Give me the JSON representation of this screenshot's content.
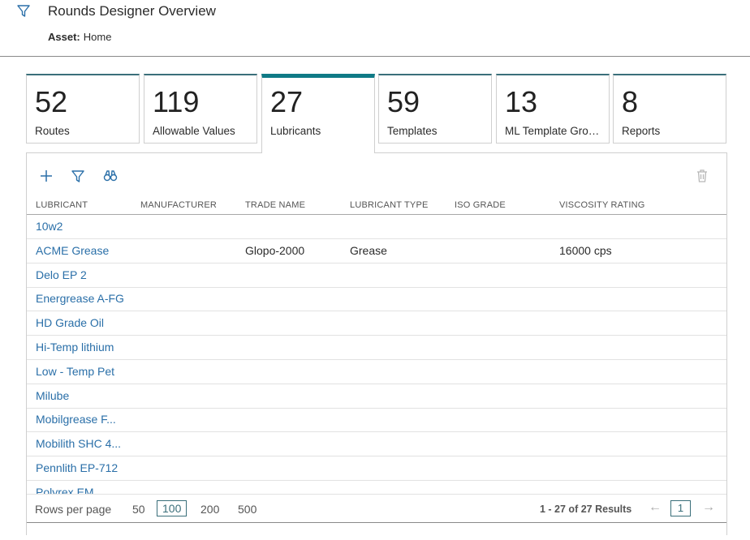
{
  "header": {
    "title": "Rounds Designer Overview",
    "asset_label": "Asset:",
    "asset_value": "Home"
  },
  "tiles": [
    {
      "count": "52",
      "label": "Routes"
    },
    {
      "count": "119",
      "label": "Allowable Values"
    },
    {
      "count": "27",
      "label": "Lubricants"
    },
    {
      "count": "59",
      "label": "Templates"
    },
    {
      "count": "13",
      "label": "ML Template Groups"
    },
    {
      "count": "8",
      "label": "Reports"
    }
  ],
  "toolbar": {
    "icons": [
      "plus-icon",
      "filter-icon",
      "binoculars-icon",
      "trash-icon"
    ]
  },
  "grid": {
    "columns": [
      "LUBRICANT",
      "MANUFACTURER",
      "TRADE NAME",
      "LUBRICANT TYPE",
      "ISO GRADE",
      "VISCOSITY RATING"
    ],
    "rows": [
      {
        "lubricant": "10w2",
        "manufacturer": "",
        "trade_name": "",
        "type": "",
        "iso": "",
        "viscosity": ""
      },
      {
        "lubricant": "ACME Grease",
        "manufacturer": "",
        "trade_name": "Glopo-2000",
        "type": "Grease",
        "iso": "",
        "viscosity": "16000 cps"
      },
      {
        "lubricant": "Delo EP 2",
        "manufacturer": "",
        "trade_name": "",
        "type": "",
        "iso": "",
        "viscosity": ""
      },
      {
        "lubricant": "Energrease A-FG",
        "manufacturer": "",
        "trade_name": "",
        "type": "",
        "iso": "",
        "viscosity": ""
      },
      {
        "lubricant": "HD Grade Oil",
        "manufacturer": "",
        "trade_name": "",
        "type": "",
        "iso": "",
        "viscosity": ""
      },
      {
        "lubricant": "Hi-Temp lithium",
        "manufacturer": "",
        "trade_name": "",
        "type": "",
        "iso": "",
        "viscosity": ""
      },
      {
        "lubricant": "Low - Temp Pet",
        "manufacturer": "",
        "trade_name": "",
        "type": "",
        "iso": "",
        "viscosity": ""
      },
      {
        "lubricant": "Milube",
        "manufacturer": "",
        "trade_name": "",
        "type": "",
        "iso": "",
        "viscosity": ""
      },
      {
        "lubricant": "Mobilgrease F...",
        "manufacturer": "",
        "trade_name": "",
        "type": "",
        "iso": "",
        "viscosity": ""
      },
      {
        "lubricant": "Mobilith SHC 4...",
        "manufacturer": "",
        "trade_name": "",
        "type": "",
        "iso": "",
        "viscosity": ""
      },
      {
        "lubricant": "Pennlith EP-712",
        "manufacturer": "",
        "trade_name": "",
        "type": "",
        "iso": "",
        "viscosity": ""
      },
      {
        "lubricant": "Polyrex EM",
        "manufacturer": "",
        "trade_name": "",
        "type": "",
        "iso": "",
        "viscosity": ""
      }
    ]
  },
  "pager": {
    "rows_per_page_label": "Rows per page",
    "options": [
      "50",
      "100",
      "200",
      "500"
    ],
    "selected": "100",
    "results": "1 - 27 of 27 Results",
    "prev": "←",
    "next": "→",
    "page": "1"
  },
  "colors": {
    "accent": "#0f7a86",
    "link": "#2a6fa8"
  }
}
